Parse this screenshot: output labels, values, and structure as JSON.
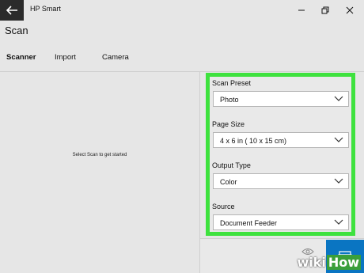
{
  "window": {
    "app_title": "HP Smart",
    "controls": [
      "minimize-icon",
      "restore-icon",
      "close-icon"
    ]
  },
  "page": {
    "title": "Scan"
  },
  "tabs": [
    {
      "label": "Scanner",
      "active": true
    },
    {
      "label": "Import",
      "active": false
    },
    {
      "label": "Camera",
      "active": false
    }
  ],
  "preview": {
    "hint": "Select Scan to get started"
  },
  "settings": {
    "highlight_color": "#3ee23e",
    "fields": [
      {
        "label": "Scan Preset",
        "value": "Photo"
      },
      {
        "label": "Page Size",
        "value": "4 x 6 in ( 10 x 15 cm)"
      },
      {
        "label": "Output Type",
        "value": "Color"
      },
      {
        "label": "Source",
        "value": "Document Feeder"
      }
    ]
  },
  "actions": {
    "preview_icon": "eye-icon",
    "scan_icon": "scanner-icon",
    "scan_color": "#0a75c2"
  },
  "watermark": {
    "part1": "wiki",
    "part2": "How"
  }
}
